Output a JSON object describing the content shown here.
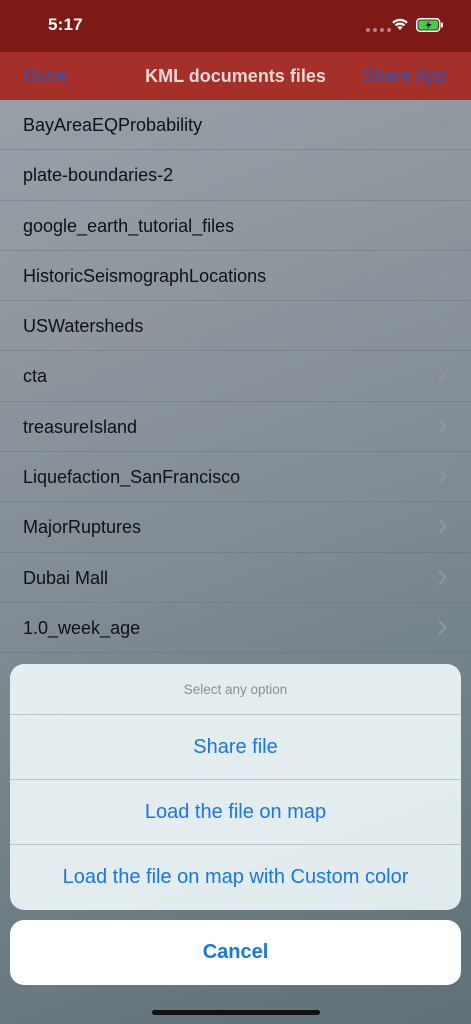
{
  "status_bar": {
    "time": "5:17"
  },
  "nav_bar": {
    "left_button": "Done",
    "title": "KML documents files",
    "right_button": "Share App"
  },
  "files": [
    {
      "label": "BayAreaEQProbability"
    },
    {
      "label": "plate-boundaries-2"
    },
    {
      "label": "google_earth_tutorial_files"
    },
    {
      "label": "HistoricSeismographLocations"
    },
    {
      "label": "USWatersheds"
    },
    {
      "label": "cta"
    },
    {
      "label": "treasureIsland"
    },
    {
      "label": "Liquefaction_SanFrancisco"
    },
    {
      "label": "MajorRuptures"
    },
    {
      "label": "Dubai Mall"
    },
    {
      "label": "1.0_week_age"
    }
  ],
  "action_sheet": {
    "title": "Select any option",
    "actions": [
      {
        "label": "Share file"
      },
      {
        "label": "Load the file on map"
      },
      {
        "label": "Load the file on map with Custom color"
      }
    ],
    "cancel": "Cancel"
  },
  "colors": {
    "status_bar_bg": "#7e1a16",
    "nav_bar_bg": "#a5302a",
    "nav_button": "#2f55b8",
    "action_blue": "#1777e8"
  }
}
